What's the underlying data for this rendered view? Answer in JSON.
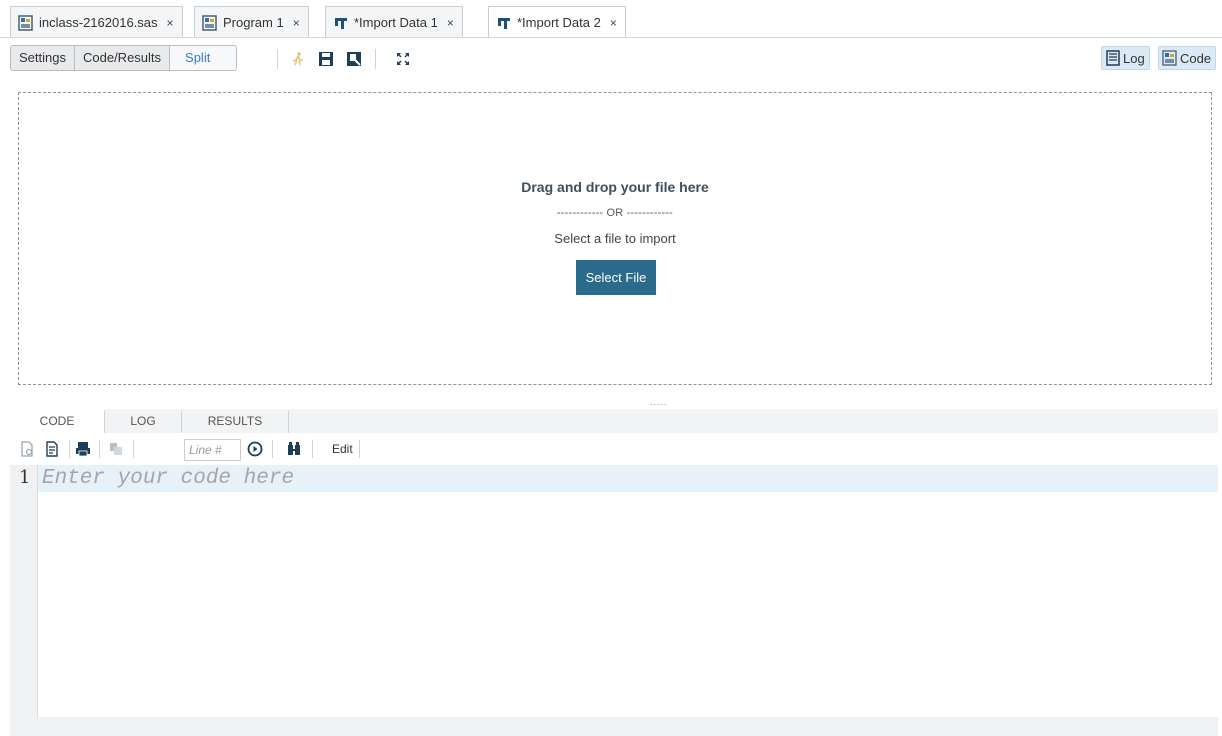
{
  "tabs": [
    {
      "label": "inclass-2162016.sas",
      "close": "×"
    },
    {
      "label": "Program 1",
      "close": "×"
    },
    {
      "label": "*Import Data 1",
      "close": "×"
    },
    {
      "label": "*Import Data 2",
      "close": "×"
    }
  ],
  "toolbar": {
    "settings_label": "Settings",
    "code_results_label": "Code/Results",
    "split_label": "Split",
    "log_label": "Log",
    "code_label": "Code"
  },
  "dropzone": {
    "title": "Drag and drop your file here",
    "or_text": "------------ OR ------------",
    "subtitle": "Select a file to import",
    "button_label": "Select File"
  },
  "grip": ".....",
  "lower_tabs": {
    "code": "CODE",
    "log": "LOG",
    "results": "RESULTS"
  },
  "editor_toolbar": {
    "line_placeholder": "Line #",
    "edit_label": "Edit"
  },
  "editor": {
    "line_number": "1",
    "placeholder": "Enter your code here"
  },
  "colors": {
    "accent": "#2a6a8a",
    "dropzone_border": "#7d98ab",
    "split_text": "#3b7cc4",
    "active_line": "#e6f1f9"
  }
}
